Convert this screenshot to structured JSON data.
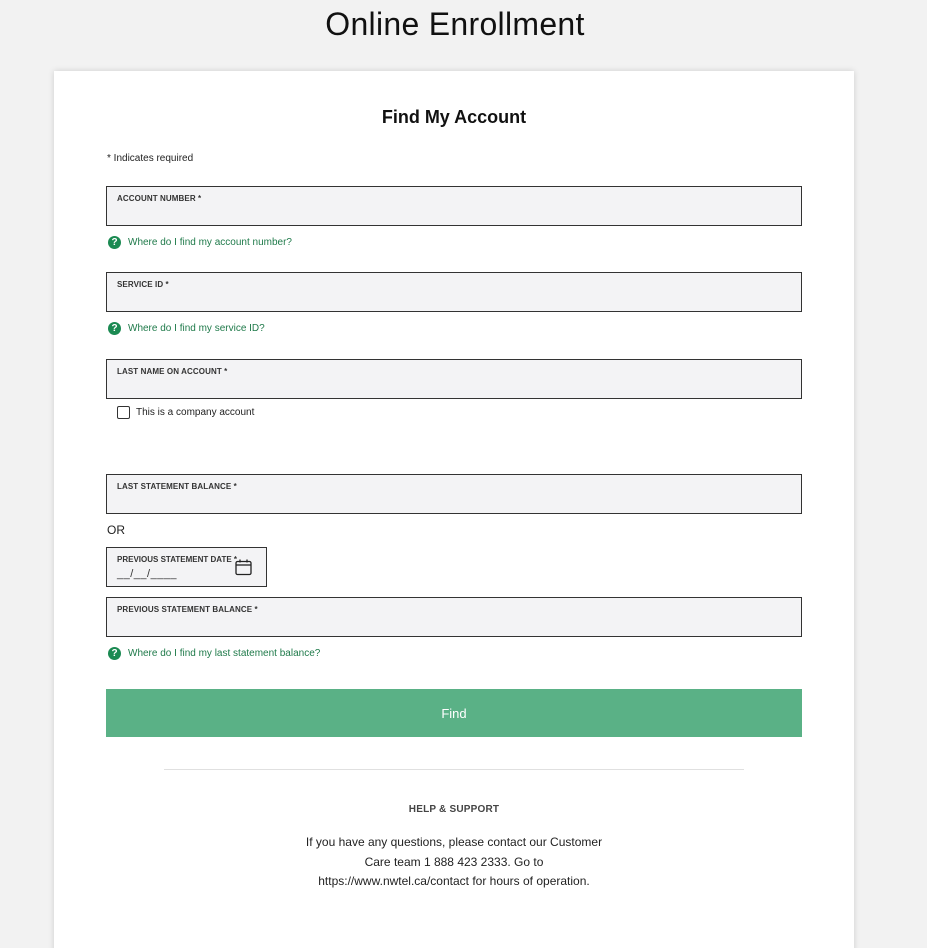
{
  "page": {
    "title": "Online Enrollment"
  },
  "card": {
    "title": "Find My Account",
    "required_note": "* Indicates required"
  },
  "fields": {
    "account_number": {
      "label": "ACCOUNT NUMBER *",
      "value": ""
    },
    "service_id": {
      "label": "SERVICE ID *",
      "value": ""
    },
    "last_name": {
      "label": "LAST NAME ON ACCOUNT *",
      "value": ""
    },
    "last_statement_balance": {
      "label": "LAST STATEMENT BALANCE *",
      "value": ""
    },
    "previous_statement_date": {
      "label": "PREVIOUS STATEMENT DATE *",
      "placeholder": "__/__/____"
    },
    "previous_statement_balance": {
      "label": "PREVIOUS STATEMENT BALANCE *",
      "value": ""
    }
  },
  "help_links": {
    "account_number": "Where do I find my account number?",
    "service_id": "Where do I find my service ID?",
    "statement_balance": "Where do I find my last statement balance?"
  },
  "company_checkbox": {
    "label": "This is a company account",
    "checked": false
  },
  "or_text": "OR",
  "find_button": {
    "label": "Find"
  },
  "support": {
    "title": "HELP & SUPPORT",
    "text": "If you have any questions, please contact our Customer Care team 1 888 423 2333.  Go to https://www.nwtel.ca/contact for hours of operation."
  },
  "icons": {
    "help": "question-circle-icon",
    "calendar": "calendar-icon"
  },
  "colors": {
    "accent_green": "#5ab186",
    "link_green": "#1f7a4a",
    "field_background": "#f3f3f5"
  }
}
